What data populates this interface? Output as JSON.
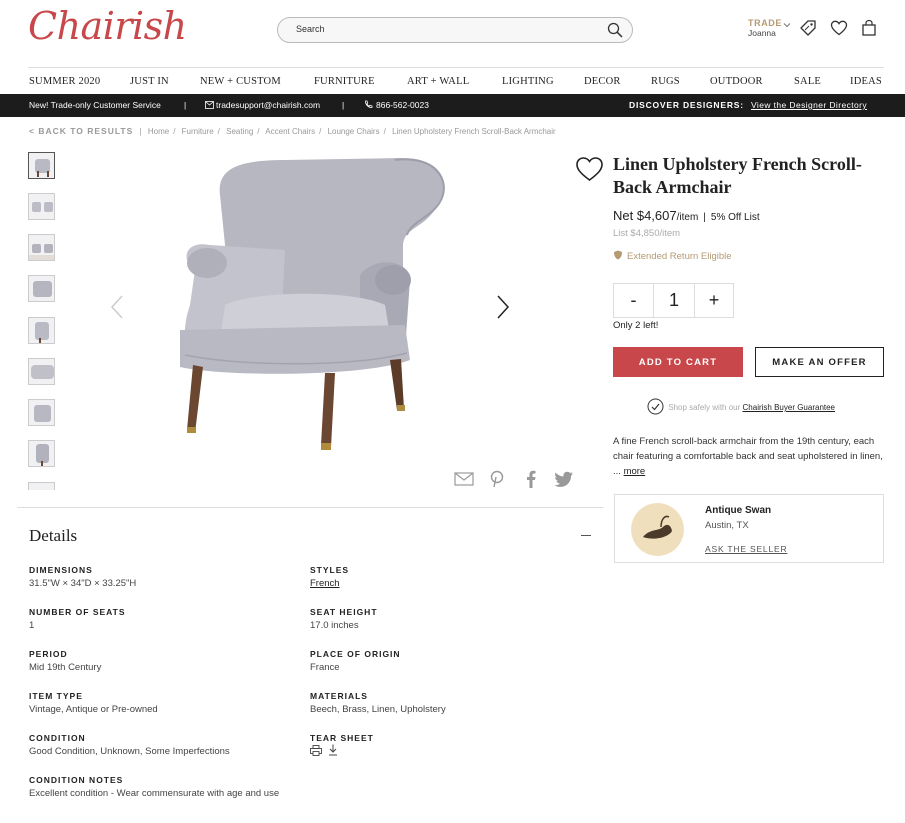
{
  "header": {
    "logo": "Chairish",
    "search_placeholder": "Search",
    "trade_label": "TRADE",
    "trade_user": "Joanna"
  },
  "nav": [
    "SUMMER 2020",
    "JUST IN",
    "NEW + CUSTOM",
    "FURNITURE",
    "ART + WALL",
    "LIGHTING",
    "DECOR",
    "RUGS",
    "OUTDOOR",
    "SALE",
    "IDEAS"
  ],
  "promo": {
    "left": "New! Trade-only Customer Service",
    "email": "tradesupport@chairish.com",
    "phone": "866-562-0023",
    "discover": "DISCOVER DESIGNERS:",
    "directory": "View the Designer Directory"
  },
  "breadcrumb": {
    "back": "< BACK TO RESULTS",
    "items": [
      "Home",
      "Furniture",
      "Seating",
      "Accent Chairs",
      "Lounge Chairs",
      "Linen Upholstery French Scroll-Back Armchair"
    ]
  },
  "product": {
    "title": "Linen Upholstery French Scroll-Back Armchair",
    "net_label": "Net $4,607",
    "net_unit": "/item",
    "discount": "5% Off List",
    "list_price": "List $4,850/item",
    "returns": "Extended Return Eligible",
    "qty_minus": "-",
    "qty_value": "1",
    "qty_plus": "+",
    "stock": "Only 2 left!",
    "add_to_cart": "ADD TO CART",
    "make_offer": "MAKE AN OFFER",
    "guarantee_text": "Shop safely with our",
    "guarantee_link": "Chairish Buyer Guarantee",
    "description": "A fine French scroll-back armchair from the 19th century, each chair featuring a comfortable back and seat upholstered in linen, ...",
    "more": "more"
  },
  "seller": {
    "name": "Antique Swan",
    "location": "Austin, TX",
    "ask": "ASK THE SELLER"
  },
  "details": {
    "title": "Details",
    "left": [
      {
        "label": "DIMENSIONS",
        "value": "31.5\"W × 34\"D × 33.25\"H"
      },
      {
        "label": "NUMBER OF SEATS",
        "value": "1"
      },
      {
        "label": "PERIOD",
        "value": "Mid 19th Century"
      },
      {
        "label": "ITEM TYPE",
        "value": "Vintage, Antique or Pre-owned"
      },
      {
        "label": "CONDITION",
        "value": "Good Condition, Unknown, Some Imperfections"
      },
      {
        "label": "CONDITION NOTES",
        "value": "Excellent condition - Wear commensurate with age and use"
      }
    ],
    "right": [
      {
        "label": "STYLES",
        "value": "French"
      },
      {
        "label": "SEAT HEIGHT",
        "value": "17.0 inches"
      },
      {
        "label": "PLACE OF ORIGIN",
        "value": "France"
      },
      {
        "label": "MATERIALS",
        "value": "Beech, Brass, Linen, Upholstery"
      },
      {
        "label": "TEAR SHEET",
        "value": ""
      }
    ]
  },
  "colors": {
    "brand": "#c8474a",
    "gold": "#b59a72",
    "promo_bg": "#1c1c1c"
  }
}
